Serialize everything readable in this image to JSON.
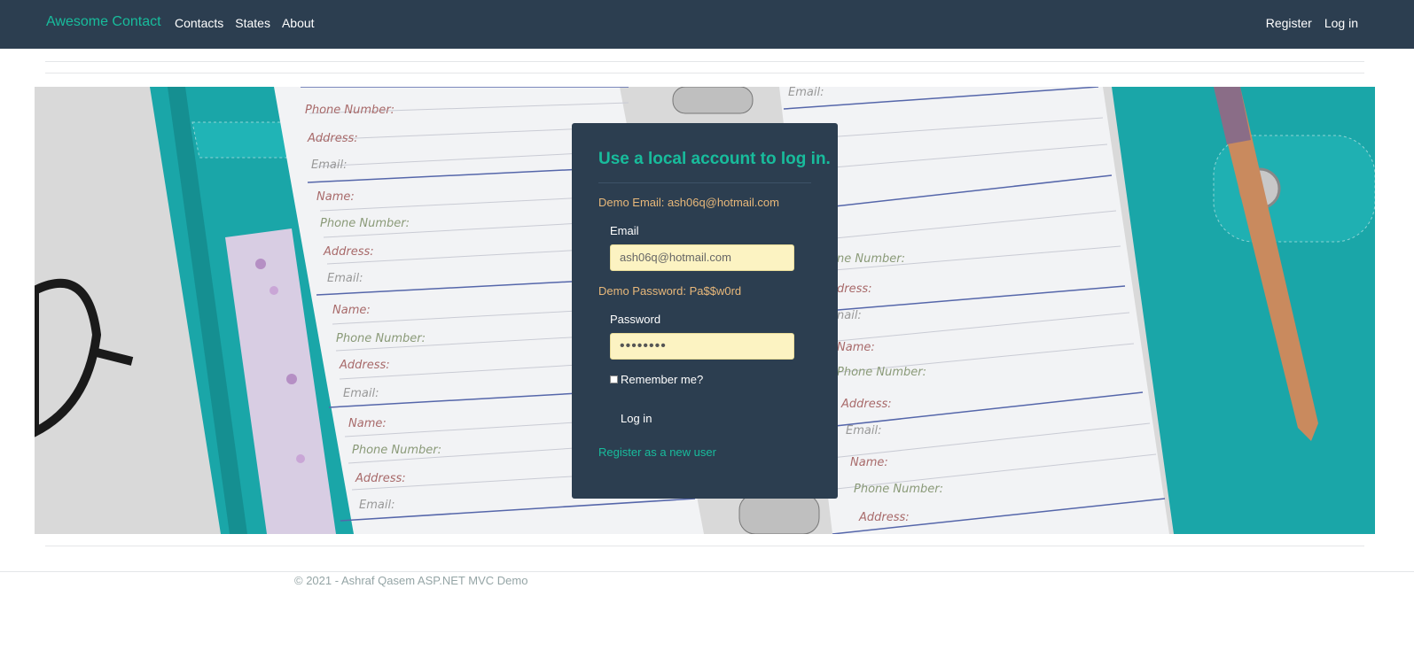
{
  "navbar": {
    "brand": "Awesome Contact",
    "links": [
      "Contacts",
      "States",
      "About"
    ],
    "right_links": [
      "Register",
      "Log in"
    ]
  },
  "hero": {
    "planner_labels": [
      "Name:",
      "Phone Number:",
      "Address:",
      "Email:"
    ]
  },
  "login": {
    "title": "Use a local account to log in.",
    "demo_email": "Demo Email: ash06q@hotmail.com",
    "email_label": "Email",
    "email_value": "ash06q@hotmail.com",
    "demo_password": "Demo Password: Pa$$w0rd",
    "password_label": "Password",
    "password_value": "••••••••",
    "remember_label": "Remember me?",
    "remember_checked": false,
    "submit_label": "Log in",
    "register_link": "Register as a new user"
  },
  "footer": {
    "text": "© 2021 - Ashraf Qasem ASP.NET MVC Demo"
  },
  "colors": {
    "navbar_bg": "#2c3e50",
    "accent": "#18bc9c",
    "demo_text": "#e8b87a",
    "input_bg": "#fcf3c2",
    "teal_cover": "#1aa6a8"
  }
}
